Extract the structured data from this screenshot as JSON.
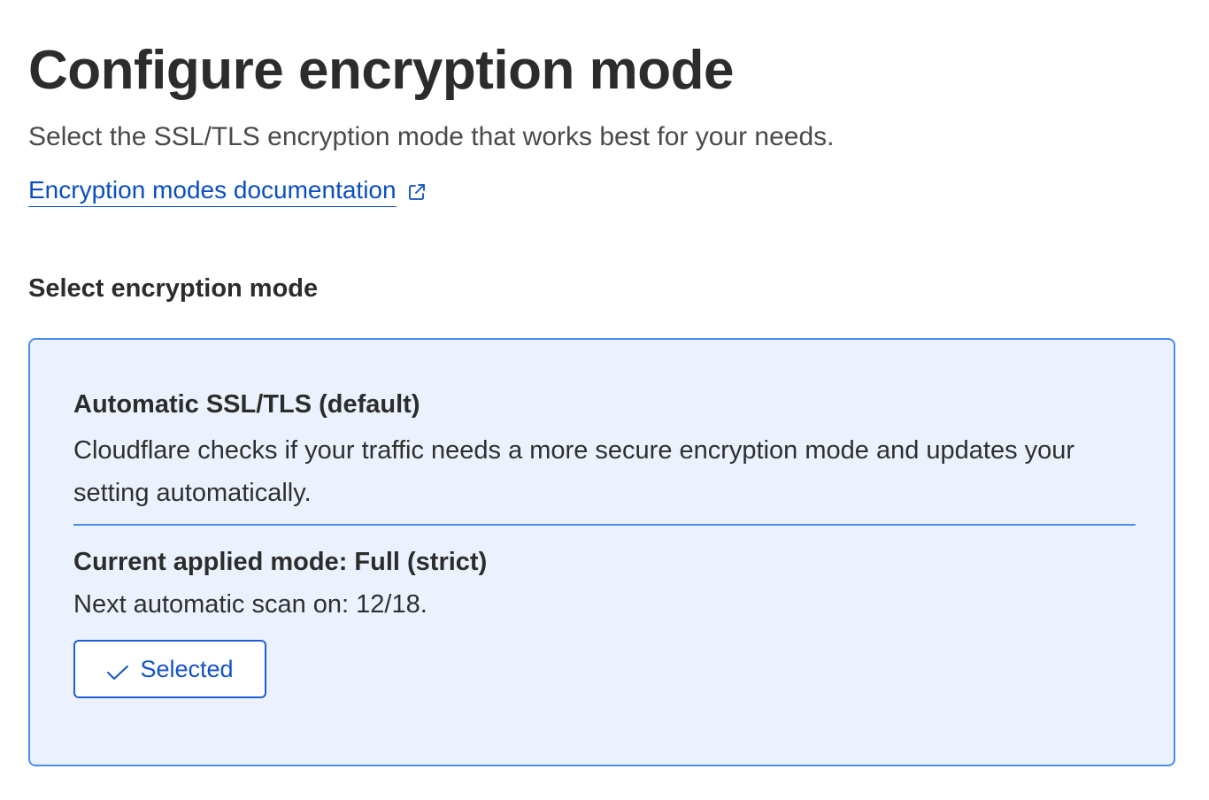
{
  "header": {
    "title": "Configure encryption mode",
    "subtitle": "Select the SSL/TLS encryption mode that works best for your needs.",
    "doc_link_label": "Encryption modes documentation",
    "doc_link_icon": "external-link-icon"
  },
  "section": {
    "heading": "Select encryption mode"
  },
  "mode_card": {
    "title": "Automatic SSL/TLS (default)",
    "description": "Cloudflare checks if your traffic needs a more secure encryption mode and updates your setting automatically.",
    "applied_mode": "Current applied mode: Full (strict)",
    "next_scan": "Next automatic scan on: 12/18.",
    "button_label": "Selected",
    "button_icon": "check-icon",
    "selected": true
  },
  "colors": {
    "link": "#0a4fbf",
    "card_background": "#ebf2fd",
    "card_border": "#4b8de6",
    "button_accent": "#1453c4"
  }
}
